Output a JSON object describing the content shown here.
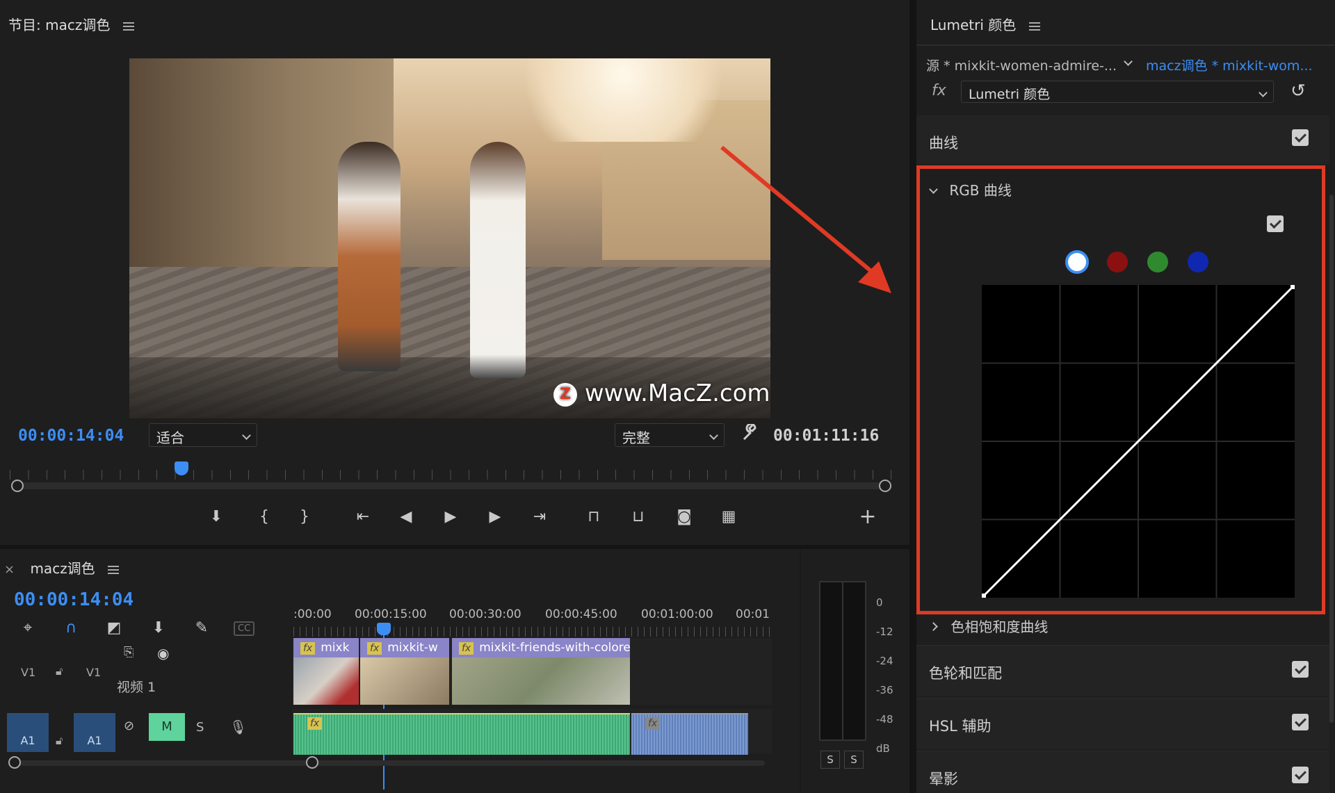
{
  "program_monitor": {
    "title": "节目: macz调色",
    "current_timecode": "00:00:14:04",
    "duration_timecode": "00:01:11:16",
    "zoom_select": "适合",
    "quality_select": "完整",
    "watermark": "www.MacZ.com"
  },
  "transport": {
    "icons": [
      "marker-icon",
      "mark-in-icon",
      "mark-out-icon",
      "go-to-in-icon",
      "step-back-icon",
      "play-icon",
      "step-forward-icon",
      "go-to-out-icon",
      "lift-icon",
      "extract-icon",
      "export-frame-icon",
      "comparison-view-icon",
      "add-button-icon"
    ]
  },
  "timeline": {
    "tab_title": "macz调色",
    "close_glyph": "×",
    "current_timecode": "00:00:14:04",
    "ruler_labels": [
      ":00:00",
      "00:00:15:00",
      "00:00:30:00",
      "00:00:45:00",
      "00:01:00:00",
      "00:01"
    ],
    "video_track": {
      "source_label": "V1",
      "target_label": "V1",
      "name": "视频 1"
    },
    "audio_track": {
      "source_label": "A1",
      "target_label": "A1",
      "mute": "M",
      "solo": "S"
    },
    "clips": [
      {
        "label": "mixk"
      },
      {
        "label": "mixkit-w"
      },
      {
        "label": "mixkit-friends-with-colore"
      }
    ],
    "fx_badge": "fx",
    "cc_label": "CC"
  },
  "audio_meter": {
    "scale": [
      "0",
      "-12",
      "-24",
      "-36",
      "-48",
      "dB"
    ],
    "solo_buttons": [
      "S",
      "S"
    ]
  },
  "lumetri": {
    "panel_title": "Lumetri 颜色",
    "source_tab": "源 * mixkit-women-admire-...",
    "sequence_tab": "macz调色 * mixkit-wom...",
    "fx_label": "fx",
    "effect_select": "Lumetri 颜色",
    "curves_section": "曲线",
    "rgb_curves": "RGB 曲线",
    "hue_sat_curves": "色相饱和度曲线",
    "color_wheels": "色轮和匹配",
    "hsl_secondary": "HSL 辅助",
    "vignette": "晕影",
    "channel_colors": [
      "#ffffff",
      "#8b1010",
      "#2f8a2f",
      "#1028b0"
    ]
  },
  "colors": {
    "accent_blue": "#3c8ef5",
    "highlight_red": "#e03a24"
  }
}
